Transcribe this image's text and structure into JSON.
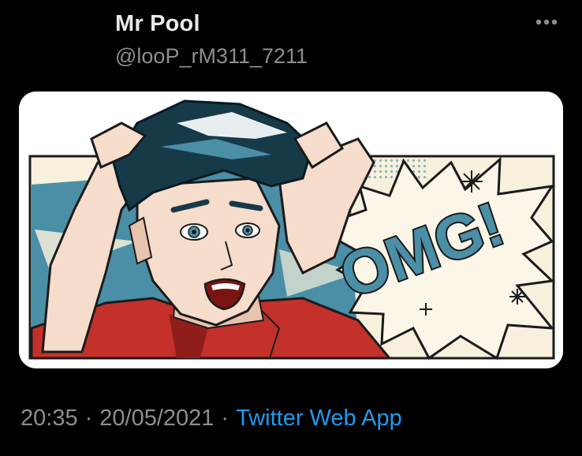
{
  "tweet": {
    "display_name": "Mr Pool",
    "handle": "@looP_rM311_7211",
    "time": "20:35",
    "date": "20/05/2021",
    "separator": "·",
    "source": "Twitter Web App",
    "more_icon": "more-horizontal-icon"
  },
  "media": {
    "burst_text": "OMG!",
    "colors": {
      "teal": "#4a8fa6",
      "cream": "#f7f0dc",
      "red": "#c3312a",
      "skin": "#f6dccb",
      "hair": "#173a49"
    }
  },
  "colors": {
    "background": "#000000",
    "name": "#e7e9ea",
    "secondary": "#8b8f94",
    "link": "#1d9bf0"
  }
}
